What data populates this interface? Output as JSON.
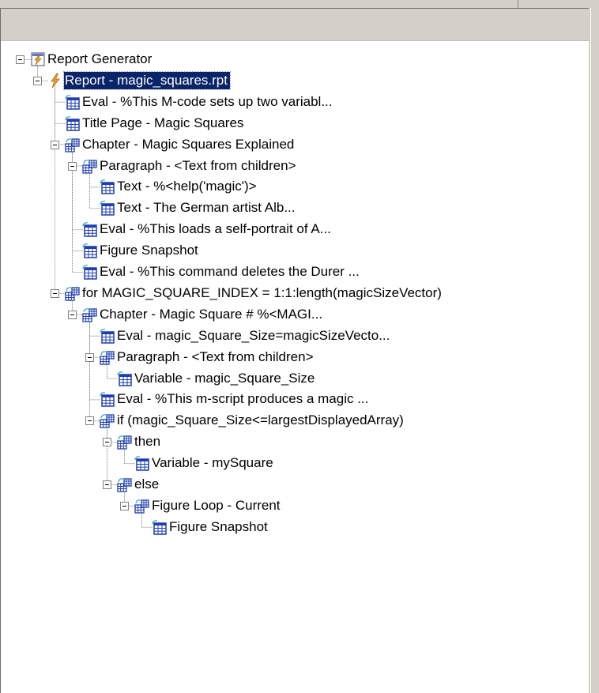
{
  "colors": {
    "window_bg": "#d4d0c8",
    "tree_bg": "#ffffff",
    "selection_bg": "#0a246a",
    "selection_text": "#ffffff",
    "component_icon": "#1f3fae",
    "component_icon_accent": "#3fb0c8",
    "lightning_icon": "#f0a020"
  },
  "tree": [
    {
      "label": "Report Generator",
      "depth": 0,
      "icon": "report-generator-icon",
      "expanded": true
    },
    {
      "label": "Report - magic_squares.rpt",
      "depth": 1,
      "icon": "lightning-report-icon",
      "expanded": true,
      "selected": true
    },
    {
      "label": "Eval - %This M-code sets up two variabl...",
      "depth": 2,
      "icon": "component-icon"
    },
    {
      "label": "Title Page - Magic Squares",
      "depth": 2,
      "icon": "component-icon"
    },
    {
      "label": "Chapter - Magic Squares Explained",
      "depth": 2,
      "icon": "parent-component-icon",
      "expanded": true
    },
    {
      "label": "Paragraph - <Text from children>",
      "depth": 3,
      "icon": "parent-component-icon",
      "expanded": true
    },
    {
      "label": "Text - %<help('magic')>",
      "depth": 4,
      "icon": "component-icon"
    },
    {
      "label": "Text - The German artist Alb...",
      "depth": 4,
      "icon": "component-icon"
    },
    {
      "label": "Eval - %This loads a self-portrait of A...",
      "depth": 3,
      "icon": "component-icon"
    },
    {
      "label": "Figure Snapshot",
      "depth": 3,
      "icon": "component-icon"
    },
    {
      "label": "Eval - %This command deletes the Durer ...",
      "depth": 3,
      "icon": "component-icon"
    },
    {
      "label": "for MAGIC_SQUARE_INDEX = 1:1:length(magicSizeVector)",
      "depth": 2,
      "icon": "parent-component-icon",
      "expanded": true
    },
    {
      "label": "Chapter - Magic Square # %<MAGI...",
      "depth": 3,
      "icon": "parent-component-icon",
      "expanded": true
    },
    {
      "label": "Eval - magic_Square_Size=magicSizeVecto...",
      "depth": 4,
      "icon": "component-icon"
    },
    {
      "label": "Paragraph - <Text from children>",
      "depth": 4,
      "icon": "parent-component-icon",
      "expanded": true
    },
    {
      "label": "Variable - magic_Square_Size",
      "depth": 5,
      "icon": "component-icon"
    },
    {
      "label": "Eval - %This m-script produces a magic ...",
      "depth": 4,
      "icon": "component-icon"
    },
    {
      "label": "if (magic_Square_Size<=largestDisplayedArray)",
      "depth": 4,
      "icon": "parent-component-icon",
      "expanded": true
    },
    {
      "label": "then",
      "depth": 5,
      "icon": "parent-component-icon",
      "expanded": true
    },
    {
      "label": "Variable - mySquare",
      "depth": 6,
      "icon": "component-icon"
    },
    {
      "label": "else",
      "depth": 5,
      "icon": "parent-component-icon",
      "expanded": true
    },
    {
      "label": "Figure Loop - Current",
      "depth": 6,
      "icon": "parent-component-icon",
      "expanded": true
    },
    {
      "label": "Figure Snapshot",
      "depth": 7,
      "icon": "component-icon"
    }
  ]
}
